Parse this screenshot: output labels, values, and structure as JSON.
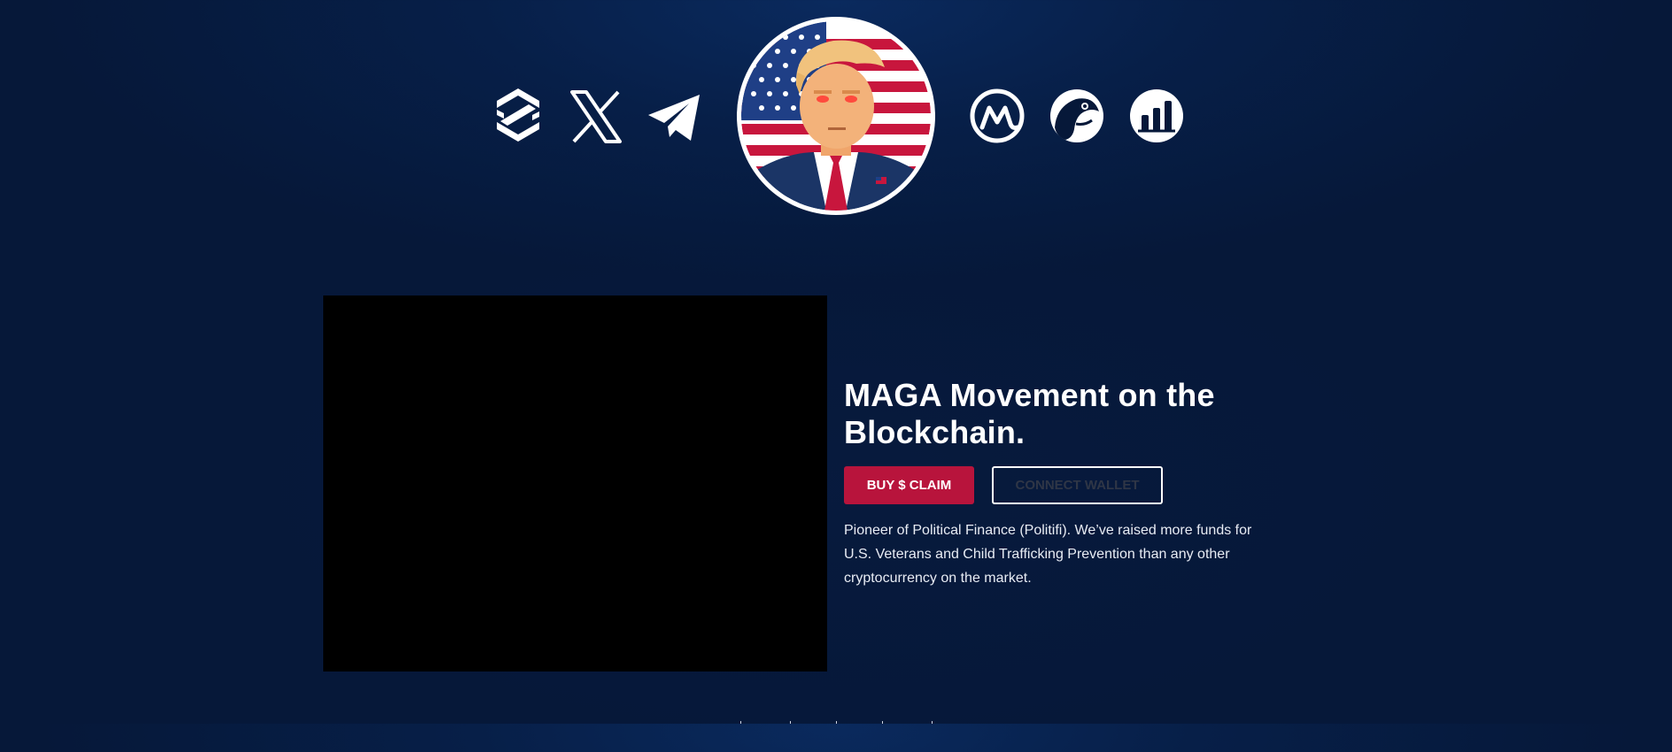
{
  "header": {
    "social_left": [
      {
        "name": "dextools-icon"
      },
      {
        "name": "x-icon"
      },
      {
        "name": "telegram-icon"
      }
    ],
    "social_right": [
      {
        "name": "coinmarketcap-icon"
      },
      {
        "name": "coingecko-icon"
      },
      {
        "name": "dexscreener-icon"
      }
    ],
    "logo": "trump-portrait-logo"
  },
  "hero": {
    "title_line1": "MAGA Movement on the",
    "title_line2": "Blockchain.",
    "buy_button": "BUY $ CLAIM",
    "connect_button": "CONNECT WALLET",
    "description": "Pioneer of Political Finance (Politifi). We’ve raised more funds for U.S. Veterans and Child Trafficking Prevention than any other cryptocurrency on the market."
  },
  "colors": {
    "background": "#061839",
    "accent_red": "#b8143c",
    "text_white": "#ffffff",
    "connect_text": "#2f3646"
  }
}
